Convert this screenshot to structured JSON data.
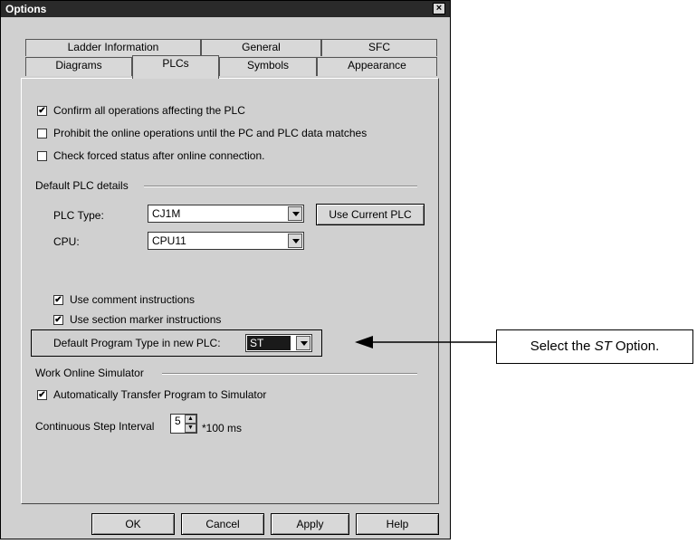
{
  "window": {
    "title": "Options",
    "close_glyph": "×"
  },
  "tabs": {
    "back_row": [
      "Ladder Information",
      "General",
      "SFC"
    ],
    "front_row": [
      "Diagrams",
      "PLCs",
      "Symbols",
      "Appearance"
    ],
    "active": "PLCs"
  },
  "options": {
    "confirm_ops": {
      "label": "Confirm all operations affecting the PLC",
      "checked": true
    },
    "prohibit_online": {
      "label": "Prohibit the online operations until the PC and PLC data matches",
      "checked": false
    },
    "check_forced": {
      "label": "Check forced status after online connection.",
      "checked": false
    }
  },
  "default_plc": {
    "group_label": "Default PLC details",
    "plc_type_label": "PLC Type:",
    "plc_type_value": "CJ1M",
    "cpu_label": "CPU:",
    "cpu_value": "CPU11",
    "use_current_label": "Use Current PLC",
    "use_comment": {
      "label": "Use comment instructions",
      "checked": true
    },
    "use_section": {
      "label": "Use section marker instructions",
      "checked": true
    },
    "program_type_label": "Default Program Type in new PLC:",
    "program_type_value": "ST"
  },
  "simulator": {
    "group_label": "Work Online Simulator",
    "auto_transfer": {
      "label": "Automatically Transfer Program to Simulator",
      "checked": true
    },
    "step_interval_label": "Continuous Step Interval",
    "step_interval_value": "5",
    "step_interval_unit": "*100 ms"
  },
  "buttons": {
    "ok": "OK",
    "cancel": "Cancel",
    "apply": "Apply",
    "help": "Help"
  },
  "callout": {
    "prefix": "Select the ",
    "emph": "ST",
    "suffix": " Option."
  },
  "check_glyph": "✔"
}
